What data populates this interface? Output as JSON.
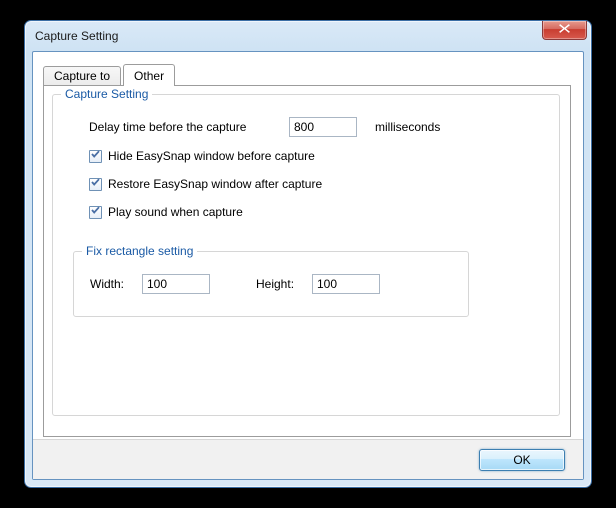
{
  "window": {
    "title": "Capture Setting"
  },
  "tabs": {
    "capture_to": "Capture to",
    "other": "Other"
  },
  "group": {
    "capture_setting": "Capture Setting",
    "fix_rect": "Fix rectangle setting"
  },
  "labels": {
    "delay_before": "Delay time before the capture",
    "milliseconds": "milliseconds",
    "hide_window": "Hide EasySnap window before capture",
    "restore_window": "Restore EasySnap window after capture",
    "play_sound": "Play sound when capture",
    "width": "Width:",
    "height": "Height:"
  },
  "values": {
    "delay": "800",
    "width": "100",
    "height": "100"
  },
  "buttons": {
    "ok": "OK"
  }
}
